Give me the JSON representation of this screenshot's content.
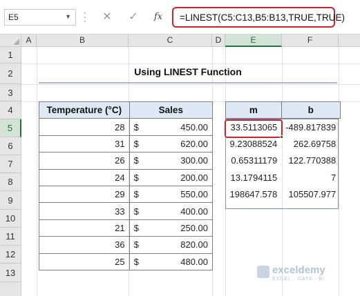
{
  "formula_bar": {
    "name_box": "E5",
    "cancel_icon": "✕",
    "enter_icon": "✓",
    "fx_label": "fx",
    "formula": "=LINEST(C5:C13,B5:B13,TRUE,TRUE)"
  },
  "columns": [
    "A",
    "B",
    "C",
    "D",
    "E",
    "F"
  ],
  "rows": [
    "1",
    "2",
    "3",
    "4",
    "5",
    "6",
    "7",
    "8",
    "9",
    "10",
    "11",
    "12",
    "13"
  ],
  "selected_column": "E",
  "selected_row": "5",
  "title": "Using LINEST Function",
  "data_table": {
    "headers": [
      "Temperature (°C)",
      "Sales"
    ],
    "currency": "$",
    "rows": [
      {
        "temp": "28",
        "sales": "450.00"
      },
      {
        "temp": "31",
        "sales": "620.00"
      },
      {
        "temp": "26",
        "sales": "300.00"
      },
      {
        "temp": "24",
        "sales": "200.00"
      },
      {
        "temp": "29",
        "sales": "550.00"
      },
      {
        "temp": "33",
        "sales": "400.00"
      },
      {
        "temp": "21",
        "sales": "250.00"
      },
      {
        "temp": "36",
        "sales": "820.00"
      },
      {
        "temp": "25",
        "sales": "480.00"
      }
    ]
  },
  "result_table": {
    "headers": [
      "m",
      "b"
    ],
    "rows": [
      {
        "m": "33.5113065",
        "b": "-489.817839"
      },
      {
        "m": "9.23088524",
        "b": "262.69758"
      },
      {
        "m": "0.65311179",
        "b": "122.770388"
      },
      {
        "m": "13.1794115",
        "b": "7"
      },
      {
        "m": "198647.578",
        "b": "105507.977"
      }
    ]
  },
  "watermark": {
    "name": "exceldemy",
    "tagline": "EXCEL · DATA · BI"
  },
  "colors": {
    "accent_red": "#d11f2c",
    "excel_green": "#217346",
    "header_fill": "#dfe8f5"
  }
}
